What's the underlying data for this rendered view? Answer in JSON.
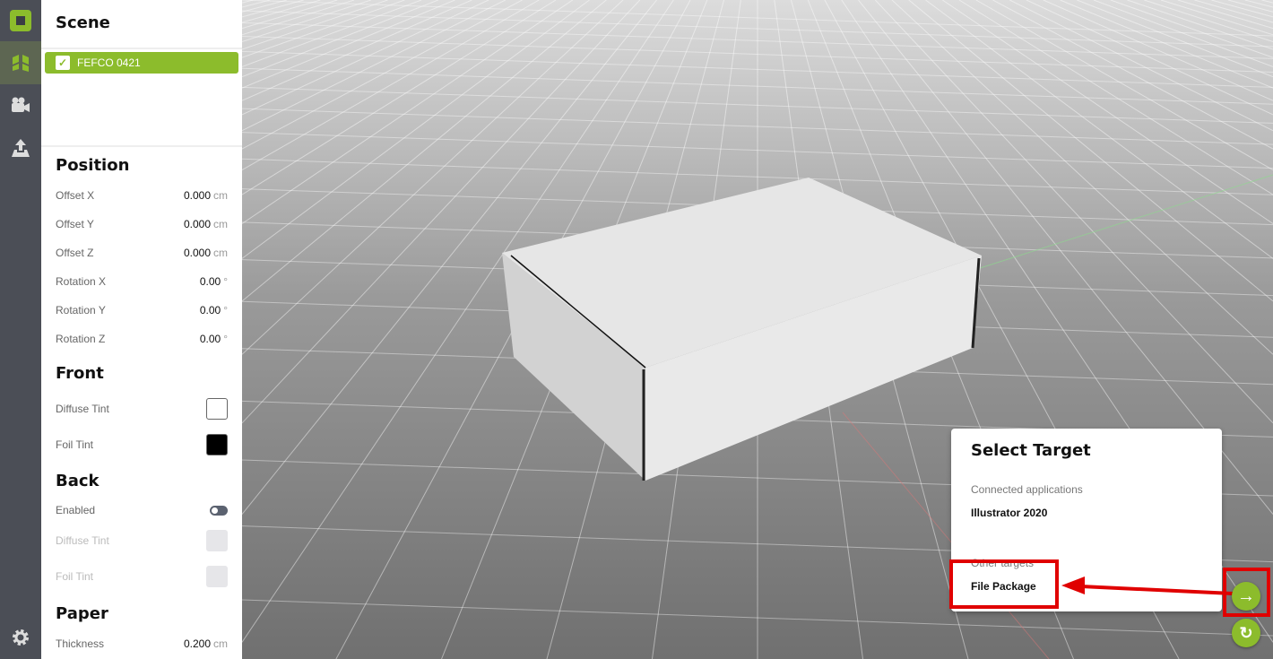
{
  "colors": {
    "accent": "#8cbc2c",
    "rail": "#4b4e56",
    "highlight": "#e00000"
  },
  "rail": {
    "icons": [
      "app-logo-icon",
      "model-icon",
      "camera-icon",
      "export-icon",
      "settings-icon"
    ]
  },
  "scene": {
    "title": "Scene",
    "items": [
      {
        "label": "FEFCO 0421",
        "checked": true,
        "selected": true
      }
    ]
  },
  "position": {
    "title": "Position",
    "rows": [
      {
        "label": "Offset X",
        "value": "0.000",
        "unit": "cm"
      },
      {
        "label": "Offset Y",
        "value": "0.000",
        "unit": "cm"
      },
      {
        "label": "Offset Z",
        "value": "0.000",
        "unit": "cm"
      },
      {
        "label": "Rotation X",
        "value": "0.00",
        "unit": "°"
      },
      {
        "label": "Rotation Y",
        "value": "0.00",
        "unit": "°"
      },
      {
        "label": "Rotation Z",
        "value": "0.00",
        "unit": "°"
      }
    ]
  },
  "front": {
    "title": "Front",
    "diffuse": "Diffuse Tint",
    "diffuse_color": "#ffffff",
    "foil": "Foil Tint",
    "foil_color": "#000000"
  },
  "back": {
    "title": "Back",
    "enabled": "Enabled",
    "enabled_on": false,
    "diffuse": "Diffuse Tint",
    "foil": "Foil Tint"
  },
  "paper": {
    "title": "Paper",
    "thickness": "Thickness",
    "thickness_value": "0.200",
    "unit": "cm"
  },
  "dialog": {
    "title": "Select Target",
    "connected": "Connected applications",
    "app": "Illustrator 2020",
    "other": "Other targets",
    "file": "File Package"
  }
}
